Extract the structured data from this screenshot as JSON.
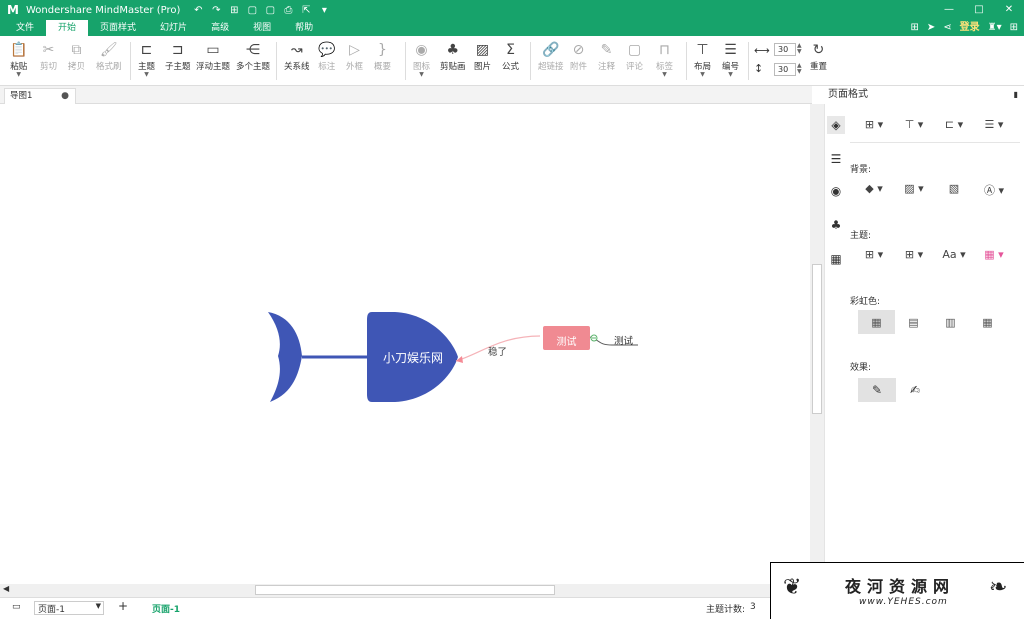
{
  "app": {
    "title": "Wondershare MindMaster (Pro)",
    "window_controls": [
      "—",
      "□",
      "✕"
    ]
  },
  "quick_access": [
    "↶",
    "↷",
    "⊞",
    "▢",
    "▢",
    "⎙",
    "⇱",
    "▾"
  ],
  "menu": {
    "tabs": [
      "文件",
      "开始",
      "页面样式",
      "幻灯片",
      "高级",
      "视图",
      "帮助"
    ],
    "active": "开始",
    "login": "登录"
  },
  "ribbon": {
    "paste": "粘贴",
    "cut": "剪切",
    "copy": "拷贝",
    "format_painter": "格式刷",
    "topic": "主题",
    "subtopic": "子主题",
    "floating_topic": "浮动主题",
    "multi_topic": "多个主题",
    "relationship": "关系线",
    "callout": "标注",
    "boundary": "外框",
    "summary": "概要",
    "icon": "图标",
    "clipart": "剪贴画",
    "picture": "图片",
    "formula": "公式",
    "hyperlink": "超链接",
    "attachment": "附件",
    "note": "注释",
    "comment": "评论",
    "tag": "标签",
    "layout": "布局",
    "numbering": "编号",
    "spacing_h": "30",
    "spacing_v": "30",
    "reset": "重置"
  },
  "document": {
    "tab_title": "导图1"
  },
  "mindmap": {
    "main_topic": "小刀娱乐网",
    "relation_label": "稳了",
    "topic": "测试",
    "subtopic": "测试",
    "fish_color": "#3f56b5",
    "topic_color": "#f08a92"
  },
  "panel": {
    "title": "页面格式",
    "background": "背景:",
    "theme": "主题:",
    "rainbow": "彩虹色:",
    "effect": "效果:",
    "font_aa": "Aa"
  },
  "status": {
    "page_select": "页面-1",
    "page_tab": "页面-1",
    "add": "+",
    "topic_count_label": "主题计数:",
    "topic_count": "3"
  },
  "watermark": {
    "title": "夜河资源网",
    "url": "www.YEHES.com"
  }
}
